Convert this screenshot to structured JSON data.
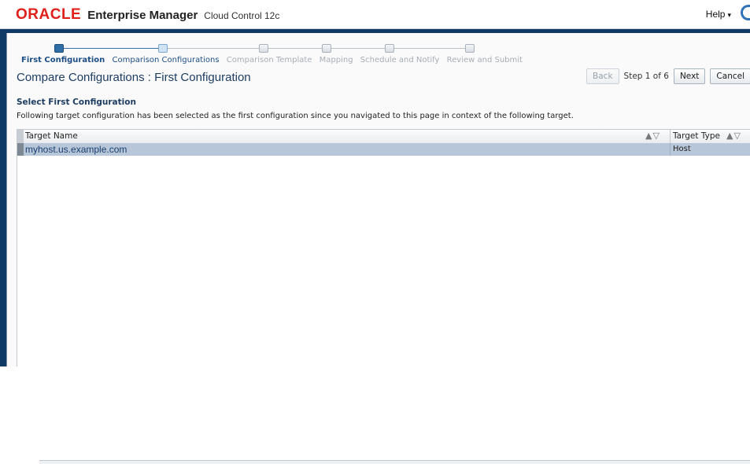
{
  "header": {
    "brand": "ORACLE",
    "product": "Enterprise Manager",
    "edition": "Cloud Control 12c",
    "help_label": "Help",
    "help_chevron": "▾"
  },
  "train": {
    "steps": [
      {
        "label": "First Configuration",
        "state": "current"
      },
      {
        "label": "Comparison Configurations",
        "state": "next"
      },
      {
        "label": "Comparison Template",
        "state": "disabled"
      },
      {
        "label": "Mapping",
        "state": "disabled"
      },
      {
        "label": "Schedule and Notify",
        "state": "disabled"
      },
      {
        "label": "Review and Submit",
        "state": "disabled"
      }
    ]
  },
  "page": {
    "title": "Compare Configurations : First Configuration",
    "back_label": "Back",
    "step_text": "Step 1 of 6",
    "next_label": "Next",
    "cancel_label": "Cancel"
  },
  "section": {
    "heading": "Select First Configuration",
    "description": "Following target configuration has been selected as the first configuration since you navigated to this page in context of the following target."
  },
  "table": {
    "columns": [
      {
        "label": "Target Name",
        "sort_icon": "▲▽"
      },
      {
        "label": "Target Type",
        "sort_icon": "▲▽"
      }
    ],
    "rows": [
      {
        "name": "myhost.us.example.com",
        "type": "Host",
        "selected": true
      }
    ]
  }
}
